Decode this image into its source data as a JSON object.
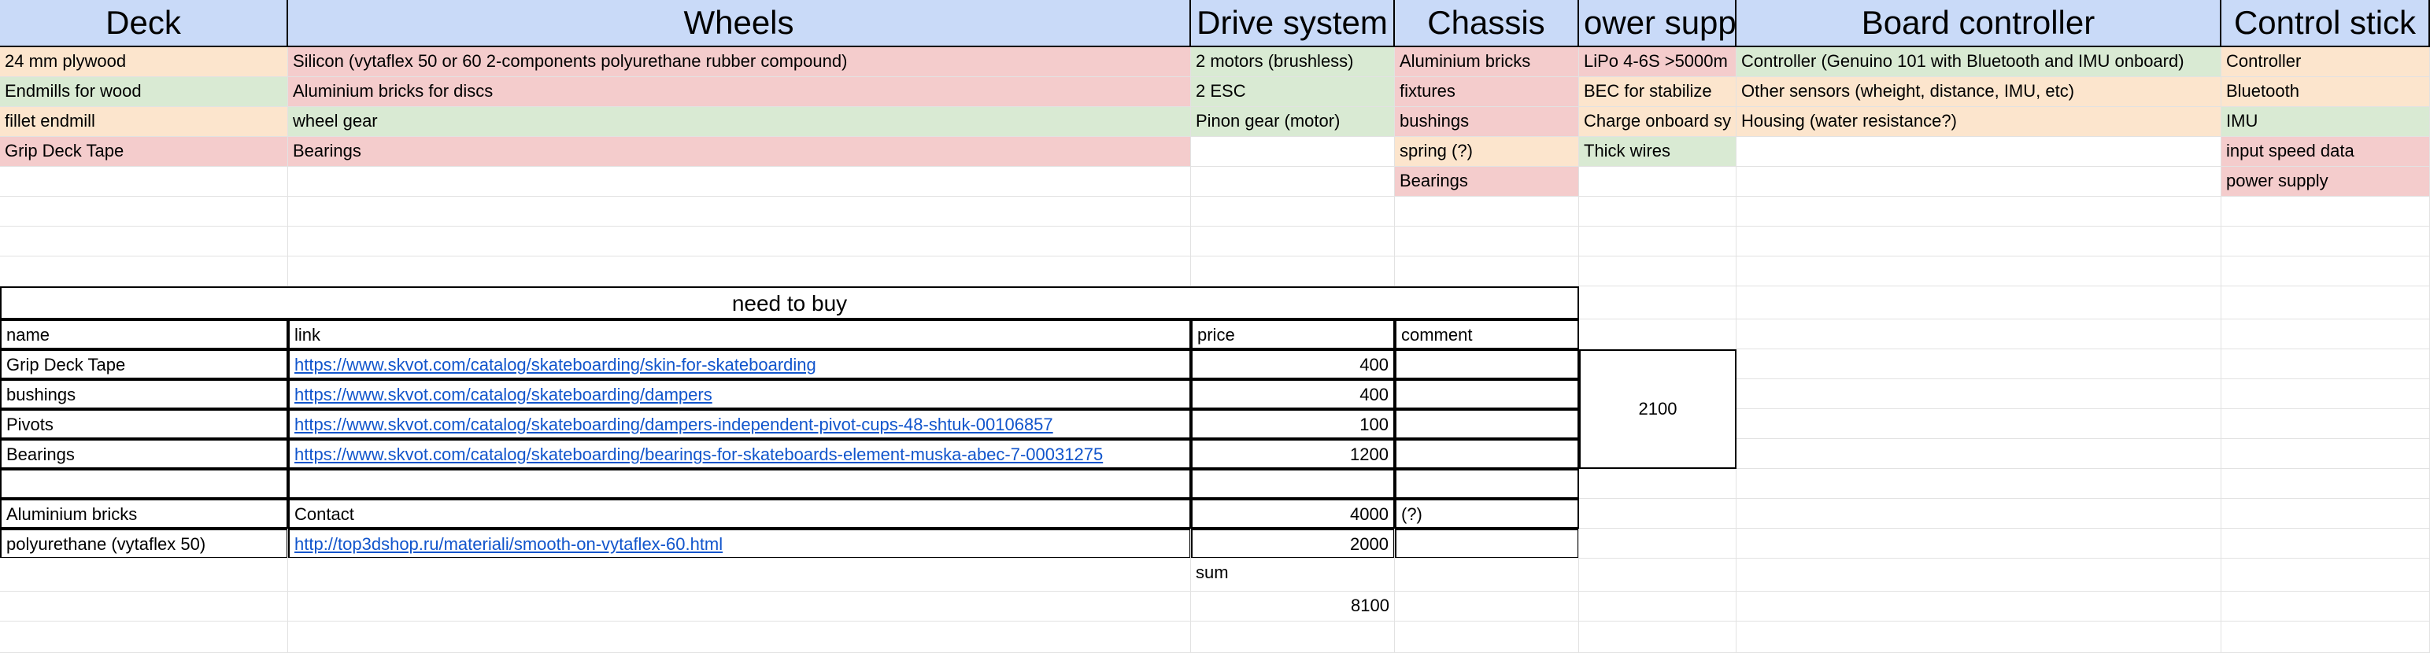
{
  "headers": [
    {
      "key": "deck",
      "label": "Deck",
      "color": "#c9daf8"
    },
    {
      "key": "wheels",
      "label": "Wheels",
      "color": "#c9daf8"
    },
    {
      "key": "drive",
      "label": "Drive system",
      "color": "#c9daf8"
    },
    {
      "key": "chassis",
      "label": "Chassis",
      "color": "#c9daf8"
    },
    {
      "key": "power",
      "label": "ower supp",
      "color": "#c9daf8"
    },
    {
      "key": "board",
      "label": "Board controller",
      "color": "#c9daf8"
    },
    {
      "key": "control",
      "label": "Control stick",
      "color": "#c9daf8"
    }
  ],
  "rows": [
    [
      {
        "text": "24 mm plywood",
        "color": "orange"
      },
      {
        "text": "Silicon (vytaflex 50 or 60 2-components polyurethane rubber compound)",
        "color": "red"
      },
      {
        "text": "2 motors (brushless)",
        "color": "green"
      },
      {
        "text": "Aluminium bricks",
        "color": "red"
      },
      {
        "text": "LiPo 4-6S >5000m",
        "color": "red"
      },
      {
        "text": "Controller (Genuino 101 with Bluetooth and IMU onboard)",
        "color": "green"
      },
      {
        "text": "Controller",
        "color": "orange"
      }
    ],
    [
      {
        "text": "Endmills for wood",
        "color": "green"
      },
      {
        "text": "Aluminium bricks for discs",
        "color": "red"
      },
      {
        "text": "2 ESC",
        "color": "green"
      },
      {
        "text": "fixtures",
        "color": "red"
      },
      {
        "text": "BEC for stabilize",
        "color": "orange"
      },
      {
        "text": "Other sensors (wheight, distance, IMU, etc)",
        "color": "orange"
      },
      {
        "text": "Bluetooth",
        "color": "orange"
      }
    ],
    [
      {
        "text": "fillet endmill",
        "color": "orange"
      },
      {
        "text": "wheel gear",
        "color": "green"
      },
      {
        "text": "Pinon gear (motor)",
        "color": "green"
      },
      {
        "text": "bushings",
        "color": "red"
      },
      {
        "text": "Charge onboard sy",
        "color": "orange"
      },
      {
        "text": "Housing (water resistance?)",
        "color": "orange"
      },
      {
        "text": "IMU",
        "color": "green"
      }
    ],
    [
      {
        "text": "Grip Deck Tape",
        "color": "red"
      },
      {
        "text": "Bearings",
        "color": "red"
      },
      {
        "text": "",
        "color": "none"
      },
      {
        "text": "spring (?)",
        "color": "orange"
      },
      {
        "text": "Thick wires",
        "color": "green"
      },
      {
        "text": "",
        "color": "none"
      },
      {
        "text": "input speed data",
        "color": "red"
      }
    ],
    [
      {
        "text": "",
        "color": "none"
      },
      {
        "text": "",
        "color": "none"
      },
      {
        "text": "",
        "color": "none"
      },
      {
        "text": "Bearings",
        "color": "red"
      },
      {
        "text": "",
        "color": "none"
      },
      {
        "text": "",
        "color": "none"
      },
      {
        "text": "power supply",
        "color": "red"
      }
    ]
  ],
  "buy": {
    "title": "need to buy",
    "columns": [
      "name",
      "link",
      "price",
      "comment"
    ],
    "items": [
      {
        "name": "Grip Deck Tape",
        "link": "https://www.skvot.com/catalog/skateboarding/skin-for-skateboarding",
        "price": "400",
        "comment": ""
      },
      {
        "name": "bushings",
        "link": "https://www.skvot.com/catalog/skateboarding/dampers",
        "price": "400",
        "comment": ""
      },
      {
        "name": "Pivots",
        "link": "https://www.skvot.com/catalog/skateboarding/dampers-independent-pivot-cups-48-shtuk-00106857",
        "price": "100",
        "comment": ""
      },
      {
        "name": "Bearings",
        "link": "https://www.skvot.com/catalog/skateboarding/bearings-for-skateboards-element-muska-abec-7-00031275",
        "price": "1200",
        "comment": ""
      },
      {
        "name": "",
        "link": "",
        "price": "",
        "comment": ""
      },
      {
        "name": "Aluminium bricks",
        "link": "Contact",
        "price": "4000",
        "comment": "(?)"
      },
      {
        "name": "polyurethane (vytaflex 50)",
        "link": "http://top3dshop.ru/materiali/smooth-on-vytaflex-60.html",
        "price": "2000",
        "comment": ""
      }
    ],
    "subtotal": "2100",
    "sum_label": "sum",
    "sum_value": "8100"
  }
}
